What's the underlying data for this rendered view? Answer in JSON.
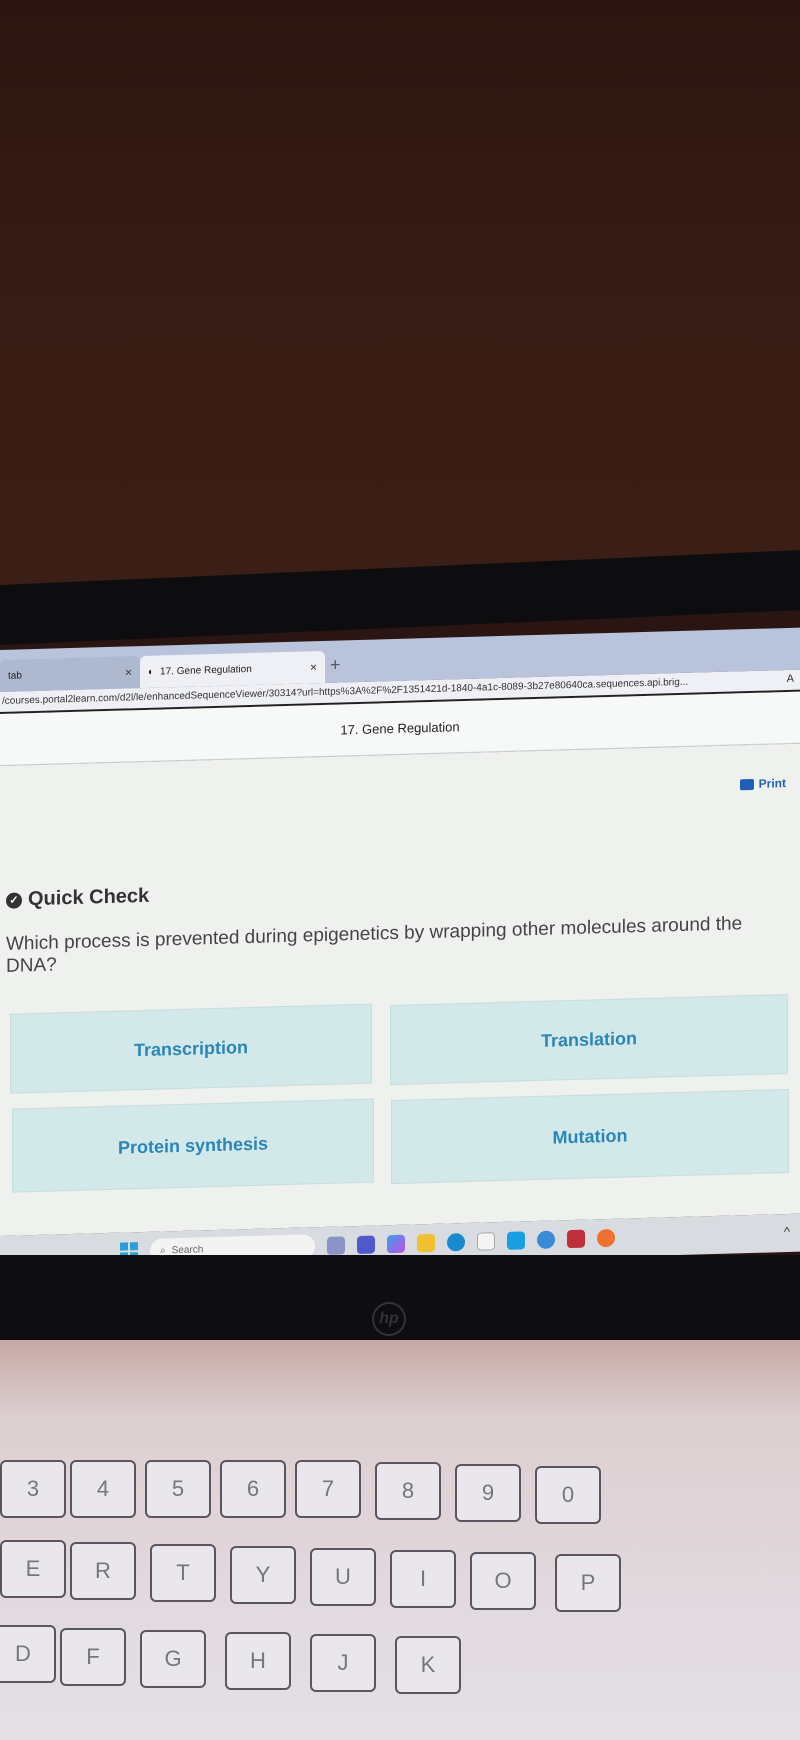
{
  "browser": {
    "tabs": [
      {
        "label": "tab",
        "close": "×"
      },
      {
        "label": "17. Gene Regulation",
        "close": "×"
      }
    ],
    "new_tab": "+",
    "url": "/courses.portal2learn.com/d2l/le/enhancedSequenceViewer/30314?url=https%3A%2F%2F1351421d-1840-4a1c-8089-3b27e80640ca.sequences.api.brig...",
    "read_aloud": "A"
  },
  "page": {
    "title": "17. Gene Regulation",
    "print_label": "Print",
    "section_title": "Quick Check",
    "question": "Which process is prevented during epigenetics by wrapping other molecules around the DNA?",
    "answers": [
      "Transcription",
      "Translation",
      "Protein synthesis",
      "Mutation"
    ],
    "accent": "#2a86b8",
    "answer_bg": "#d3e8e8"
  },
  "taskbar": {
    "search_placeholder": "Search",
    "icons": [
      "start-icon",
      "task-view-icon",
      "teams-icon",
      "copilot-icon",
      "file-explorer-icon",
      "edge-icon",
      "store-icon",
      "app-icon",
      "help-icon",
      "mcafee-icon",
      "firefox-icon"
    ],
    "tray_chevron": "^"
  },
  "keyboard": {
    "number_row": [
      "3",
      "4",
      "5",
      "6",
      "7",
      "8",
      "9",
      "0"
    ],
    "top_row": [
      "E",
      "R",
      "T",
      "Y",
      "U",
      "I",
      "O",
      "P"
    ],
    "home_row": [
      "D",
      "F",
      "G",
      "H",
      "J",
      "K"
    ]
  }
}
